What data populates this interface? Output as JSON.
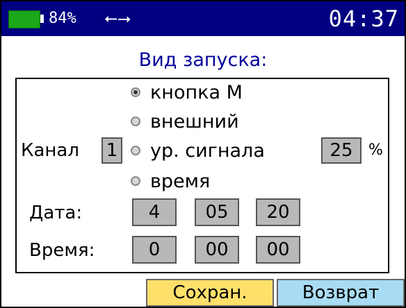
{
  "status": {
    "battery_percent": "84%",
    "battery_level": 0.84,
    "usb_icon": "usb-icon",
    "time": "04:37",
    "colors": {
      "bar": "#000080",
      "battery": "#1aa81a"
    }
  },
  "title": "Вид запуска:",
  "trigger_options": [
    {
      "label": "кнопка М",
      "selected": true
    },
    {
      "label": "внешний",
      "selected": false
    },
    {
      "label": "ур. сигнала",
      "selected": false
    },
    {
      "label": "время",
      "selected": false
    }
  ],
  "channel": {
    "label": "Канал",
    "value": "1"
  },
  "signal_level": {
    "value": "25",
    "unit": "%"
  },
  "date": {
    "label": "Дата:",
    "day": "4",
    "month": "05",
    "year": "20"
  },
  "time_setting": {
    "label": "Время:",
    "hours": "0",
    "minutes": "00",
    "seconds": "00"
  },
  "buttons": {
    "save": "Сохран.",
    "back": "Возврат"
  },
  "colors": {
    "title": "#000099",
    "save_button": "#ffe06b",
    "back_button": "#a8dcf4",
    "field": "#b8b8b8"
  }
}
